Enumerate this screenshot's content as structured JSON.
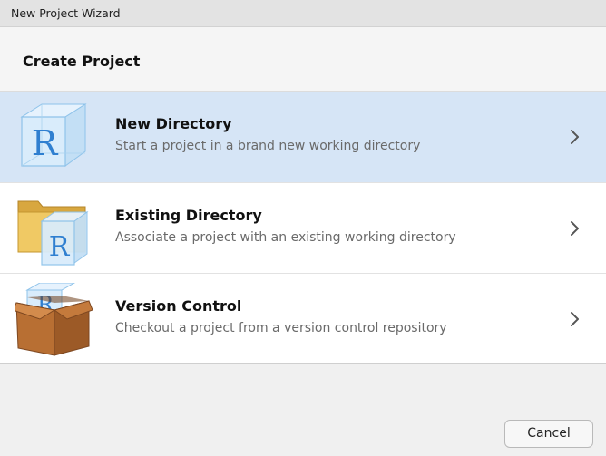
{
  "window": {
    "title": "New Project Wizard"
  },
  "header": {
    "title": "Create Project"
  },
  "options": [
    {
      "title": "New Directory",
      "description": "Start a project in a brand new working directory",
      "icon": "r-cube-icon",
      "selected": true
    },
    {
      "title": "Existing Directory",
      "description": "Associate a project with an existing working directory",
      "icon": "folder-r-icon",
      "selected": false
    },
    {
      "title": "Version Control",
      "description": "Checkout a project from a version control repository",
      "icon": "box-r-icon",
      "selected": false
    }
  ],
  "footer": {
    "cancel_label": "Cancel"
  },
  "colors": {
    "selected_background": "#d6e5f6",
    "r_blue": "#2f7fd0"
  }
}
